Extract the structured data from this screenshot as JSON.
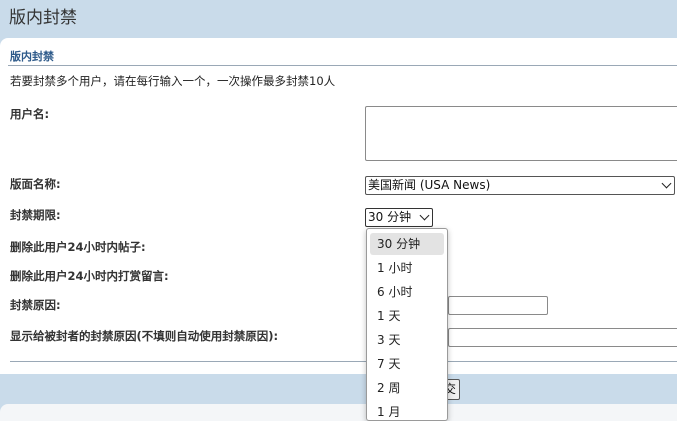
{
  "page_title": "版内封禁",
  "form": {
    "section_title": "版内封禁",
    "hint": "若要封禁多个用户，请在每行输入一个，一次操作最多封禁10人",
    "labels": {
      "username": "用户名:",
      "board": "版面名称:",
      "duration": "封禁期限:",
      "delete_posts": "删除此用户24小时内帖子:",
      "delete_tip_comments": "删除此用户24小时内打赏留言:",
      "reason": "封禁原因:",
      "reason_public": "显示给被封者的封禁原因(不填则自动使用封禁原因):"
    },
    "username_value": "",
    "board_selected": "美国新闻 (USA News)",
    "duration_selected": "30 分钟",
    "duration_options": [
      "30 分钟",
      "1 小时",
      "6 小时",
      "1 天",
      "3 天",
      "7 天",
      "2 周",
      "1 月"
    ],
    "reason_value": "",
    "reason_public_value": "",
    "submit_label": "交"
  },
  "colors": {
    "page_background": "#c9dbea",
    "section_title": "#2e5a8a",
    "option_highlight": "#e3e3e3"
  }
}
